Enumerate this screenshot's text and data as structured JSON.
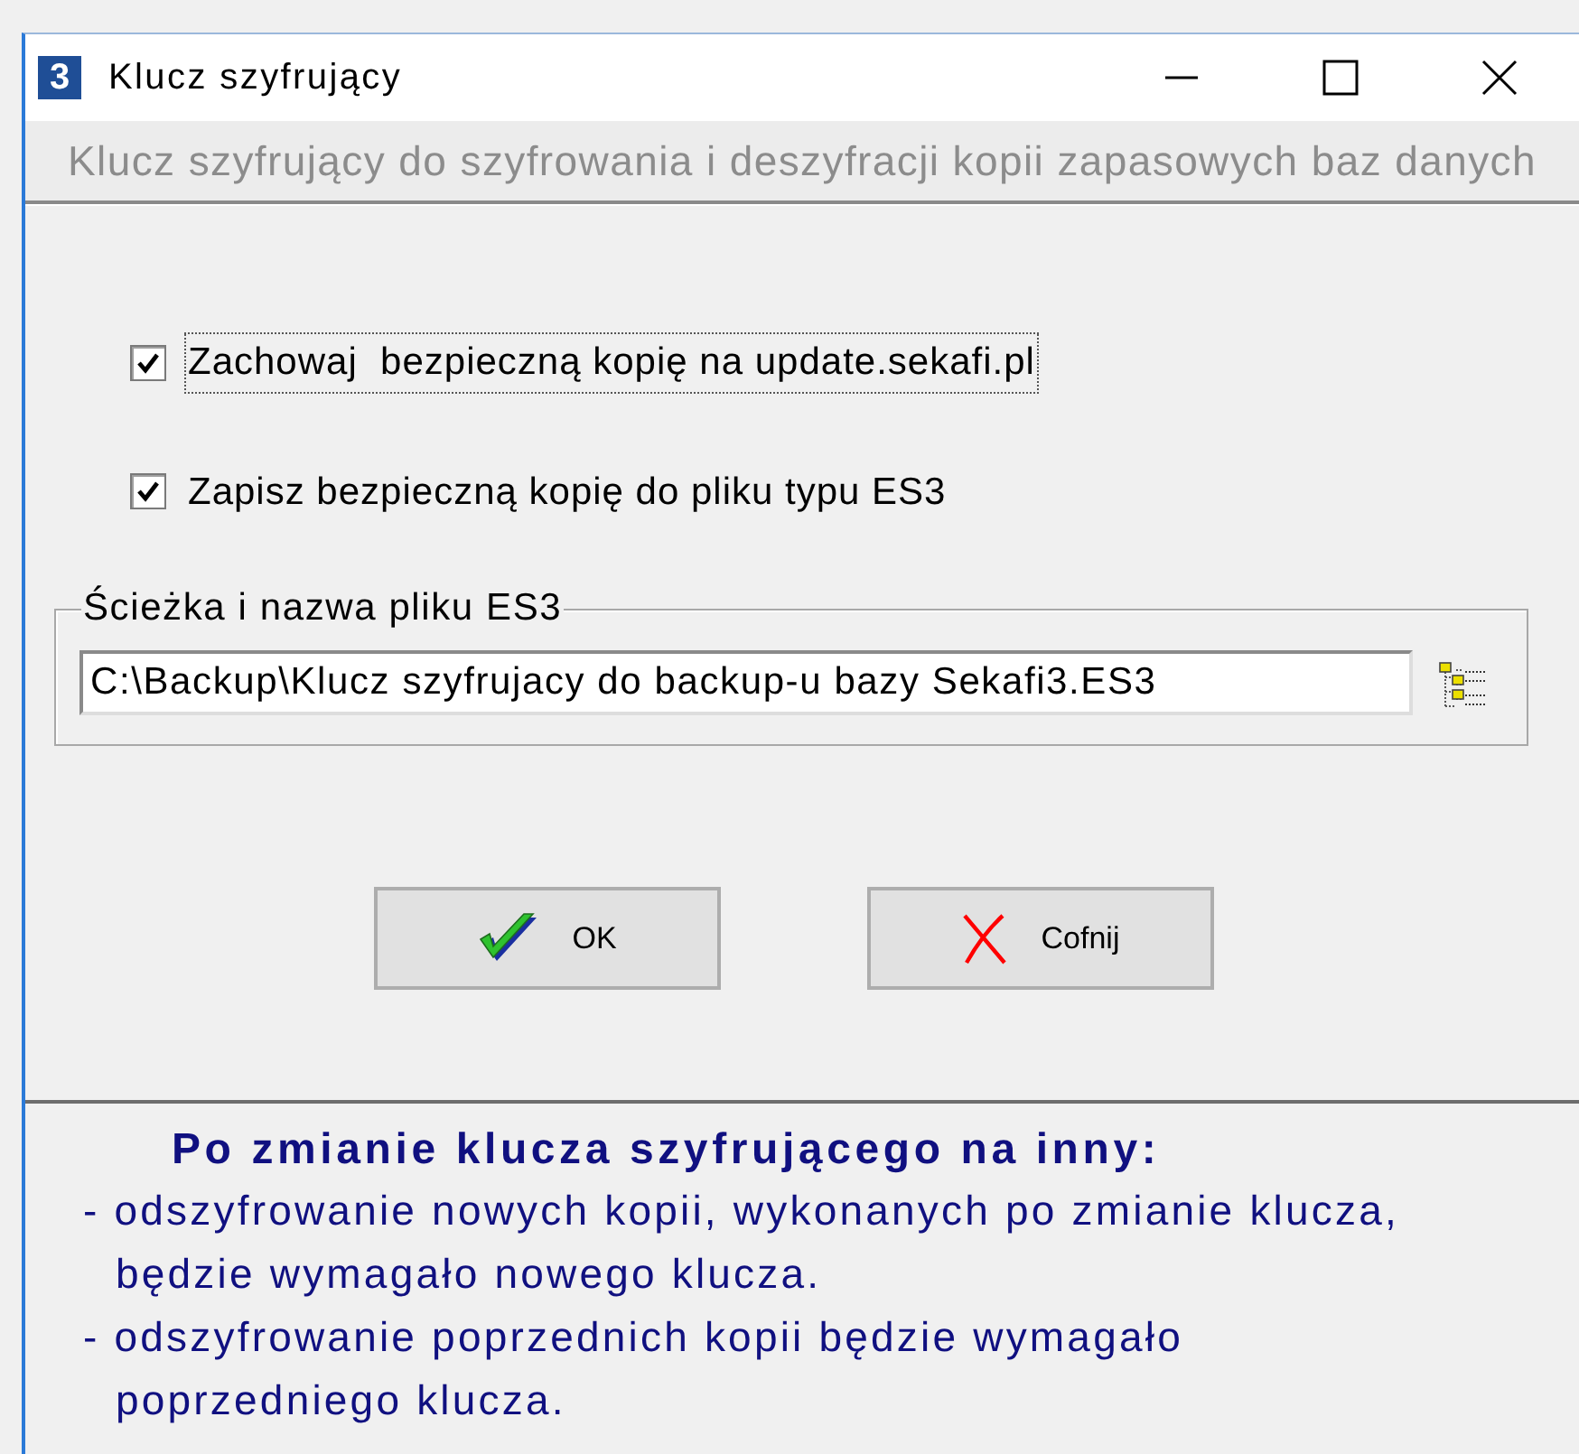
{
  "window": {
    "title": "Klucz szyfrujący",
    "app_icon_text": "3"
  },
  "subtitle": "Klucz szyfrujący do szyfrowania i deszyfracji kopii zapasowych baz danych",
  "options": [
    {
      "label": "Zachowaj  bezpieczną kopię na update.sekafi.pl",
      "checked": true,
      "focused": true
    },
    {
      "label": "Zapisz bezpieczną kopię do pliku typu ES3",
      "checked": true,
      "focused": false
    }
  ],
  "file_group": {
    "legend": "Ścieżka i nazwa pliku ES3",
    "path": "C:\\Backup\\Klucz szyfrujacy do backup-u bazy Sekafi3.ES3"
  },
  "buttons": [
    {
      "kind": "ok",
      "label": "OK"
    },
    {
      "kind": "cancel",
      "label": "Cofnij"
    }
  ],
  "notes": {
    "heading": "Po zmianie klucza szyfrującego na inny:",
    "items": [
      "- odszyfrowanie nowych kopii, wykonanych po zmianie klucza, będzie wymagało nowego klucza.",
      "- odszyfrowanie poprzednich kopii będzie wymagało poprzedniego klucza."
    ]
  }
}
